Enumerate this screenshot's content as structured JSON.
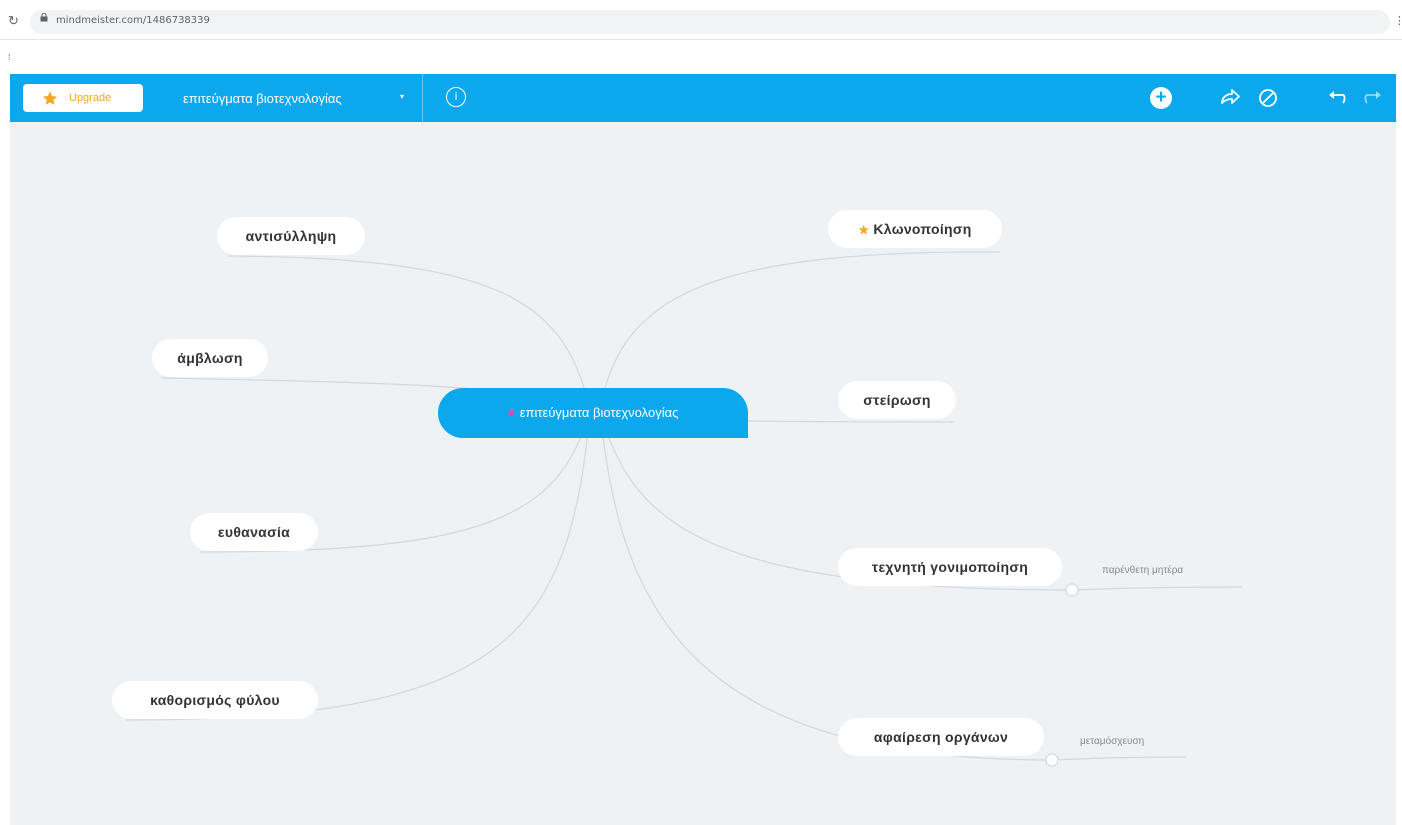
{
  "browser": {
    "url": "mindmeister.com/1486738339",
    "reload_icon": "reload-icon",
    "lock_icon": "lock-icon",
    "menu_icon": "kebab-menu-icon",
    "left_mark": "⁞"
  },
  "toolbar": {
    "upgrade_label": "Upgrade",
    "map_title": "επιτεύγματα βιοτεχνολογίας",
    "caret": "▾",
    "info_icon": "info-icon",
    "info_glyph": "i",
    "add_icon": "plus-circle-icon",
    "add_glyph": "+",
    "share_icon": "share-icon",
    "block_icon": "ban-icon",
    "undo_icon": "undo-icon",
    "redo_icon": "redo-icon",
    "accent_color": "#0ba8ee",
    "upgrade_color": "#f5a623"
  },
  "mindmap": {
    "central_topic": "επιτεύγματα βιοτεχνολογίας",
    "central_icon": "heart-icon",
    "central_color": "#0ba8ee",
    "left_topics": [
      {
        "label": "αντισύλληψη"
      },
      {
        "label": "άμβλωση"
      },
      {
        "label": "ευθανασία"
      },
      {
        "label": "καθορισμός φύλου"
      }
    ],
    "right_topics": [
      {
        "label": "Κλωνοποίηση",
        "icon": "star-icon"
      },
      {
        "label": "στείρωση"
      },
      {
        "label": "τεχνητή γονιμοποίηση",
        "subtopic": "παρένθετη μητέρα"
      },
      {
        "label": "αφαίρεση οργάνων",
        "subtopic": "μεταμόσχευση"
      }
    ]
  }
}
